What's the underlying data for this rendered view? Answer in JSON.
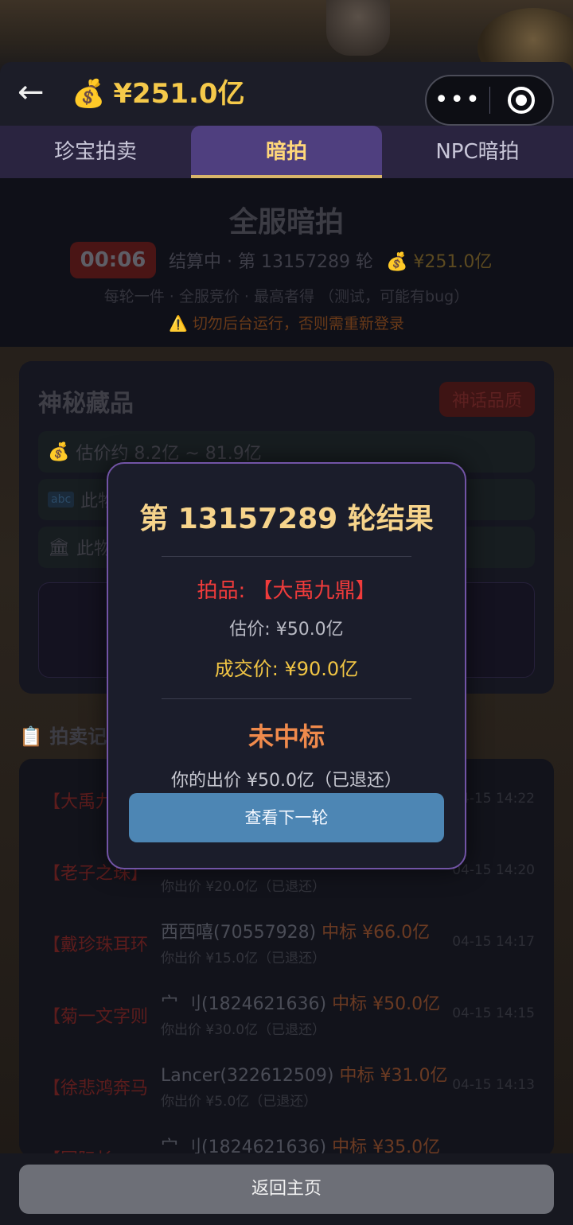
{
  "header": {
    "back_icon": "←",
    "wallet_icon": "💰",
    "wallet_amount": "¥251.0亿",
    "more_icon": "•••"
  },
  "tabs": [
    {
      "label": "珍宝拍卖",
      "active": false
    },
    {
      "label": "暗拍",
      "active": true
    },
    {
      "label": "NPC暗拍",
      "active": false
    }
  ],
  "auction": {
    "title": "全服暗拍",
    "timer": "00:06",
    "round_status": "结算中 · 第 13157289 轮",
    "wallet_icon": "💰",
    "wallet_amount": "¥251.0亿",
    "rules": "每轮一件 · 全服竞价 · 最高者得 （测试，可能有bug）",
    "warning": "⚠️ 切勿后台运行，否则需重新登录"
  },
  "treasure": {
    "title": "神秘藏品",
    "quality_badge": "神话品质",
    "estimate_icon": "💰",
    "estimate": "估价约 8.2亿 ~ 81.9亿",
    "row2_icon": "abc",
    "row2_text": "此物",
    "row3_icon": "🏛",
    "row3_text": "此物"
  },
  "records": {
    "title": "📋 拍卖记",
    "items": [
      {
        "item": "【大禹九",
        "winner": "",
        "winner_suffix": "",
        "mine": "",
        "time": "04-15 14:22"
      },
      {
        "item": "【老子之珠】",
        "winner": "",
        "winner_suffix": "",
        "mine": "你出价 ¥20.0亿（已退还）",
        "time": "04-15 14:20"
      },
      {
        "item": "【戴珍珠耳环",
        "winner": "西西嘻(70557928)",
        "winner_suffix": "中标 ¥66.0亿",
        "mine": "你出价 ¥15.0亿（已退还）",
        "time": "04-15 14:17"
      },
      {
        "item": "【菊一文字则",
        "winner": "宀 刂(1824621636)",
        "winner_suffix": "中标 ¥50.0亿",
        "mine": "你出价 ¥30.0亿（已退还）",
        "time": "04-15 14:15"
      },
      {
        "item": "【徐悲鸿奔马",
        "winner": "Lancer(322612509)",
        "winner_suffix": "中标 ¥31.0亿",
        "mine": "你出价 ¥5.0亿（已退还）",
        "time": "04-15 14:13"
      },
      {
        "item": "【国际长",
        "winner": "宀 刂(1824621636)",
        "winner_suffix": "中标 ¥35.0亿",
        "mine": "",
        "time": ""
      }
    ]
  },
  "footer": {
    "home_button": "返回主页"
  },
  "modal": {
    "title": "第 13157289 轮结果",
    "lot": "拍品: 【大禹九鼎】",
    "estimate": "估价: ¥50.0亿",
    "deal_price": "成交价: ¥90.0亿",
    "result": "未中标",
    "my_bid": "你的出价 ¥50.0亿（已退还）",
    "next_button": "查看下一轮"
  }
}
